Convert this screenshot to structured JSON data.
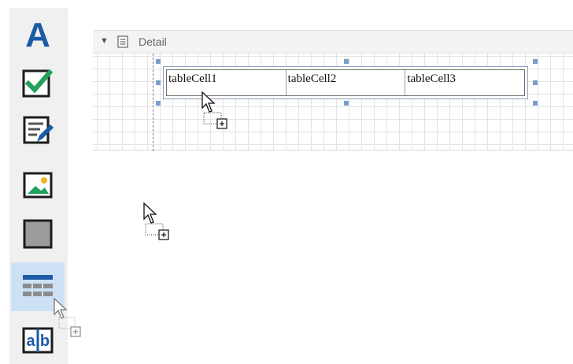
{
  "toolbox": {
    "items": [
      {
        "name": "label-tool",
        "glyph": "A"
      },
      {
        "name": "checkbox-tool"
      },
      {
        "name": "richtext-tool"
      },
      {
        "name": "picture-tool"
      },
      {
        "name": "panel-tool"
      },
      {
        "name": "table-tool",
        "selected": true
      },
      {
        "name": "character-comb-tool",
        "glyph_left": "a",
        "glyph_right": "b"
      }
    ]
  },
  "band": {
    "title": "Detail"
  },
  "table": {
    "cells": [
      "tableCell1",
      "tableCell2",
      "tableCell3"
    ]
  },
  "colors": {
    "accent": "#1d5aa6",
    "check": "#22a05b",
    "handle": "#7b9ccc",
    "selected": "#cde1f5"
  }
}
